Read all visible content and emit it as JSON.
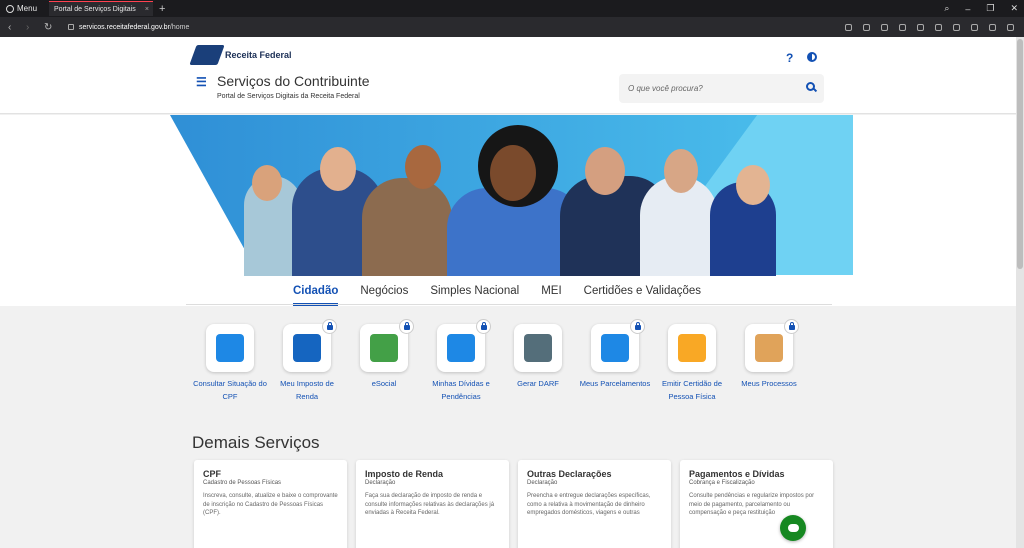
{
  "browser": {
    "menu_label": "Menu",
    "tab_title": "Portal de Serviços Digitais",
    "url_host": "servicos.receitafederal.gov.br",
    "url_path": "/home"
  },
  "header": {
    "logo_text": "Receita Federal",
    "help_label": "?",
    "title": "Serviços do Contribuinte",
    "subtitle": "Portal de Serviços Digitais da Receita Federal",
    "search_placeholder": "O que você procura?"
  },
  "tabs": [
    "Cidadão",
    "Negócios",
    "Simples Nacional",
    "MEI",
    "Certidões e Validações"
  ],
  "services": [
    {
      "label": "Consultar Situação do CPF",
      "locked": false,
      "icon": "cpf-card-icon",
      "color": "#1e88e5"
    },
    {
      "label": "Meu Imposto de Renda",
      "locked": true,
      "icon": "income-tax-icon",
      "color": "#1565c0"
    },
    {
      "label": "eSocial",
      "locked": true,
      "icon": "esocial-icon",
      "color": "#43a047"
    },
    {
      "label": "Minhas Dívidas e Pendências",
      "locked": true,
      "icon": "warning-triangle-icon",
      "color": "#1e88e5"
    },
    {
      "label": "Gerar DARF",
      "locked": false,
      "icon": "darf-barcode-icon",
      "color": "#546e7a"
    },
    {
      "label": "Meus Parcelamentos",
      "locked": true,
      "icon": "calendar-percent-icon",
      "color": "#1e88e5"
    },
    {
      "label": "Emitir Certidão de Pessoa Física",
      "locked": false,
      "icon": "certificate-pf-icon",
      "color": "#f9a825"
    },
    {
      "label": "Meus Processos",
      "locked": true,
      "icon": "folder-icon",
      "color": "#e0a35a"
    }
  ],
  "demais_title": "Demais Serviços",
  "cards": [
    {
      "title": "CPF",
      "subtitle": "Cadastro de Pessoas Físicas",
      "desc": "Inscreva, consulte, atualize e baixe o comprovante de inscrição no Cadastro de Pessoas Físicas (CPF)."
    },
    {
      "title": "Imposto de Renda",
      "subtitle": "Declaração",
      "desc": "Faça sua declaração de imposto de renda e consulte informações relativas às declarações já enviadas à Receita Federal."
    },
    {
      "title": "Outras Declarações",
      "subtitle": "Declaração",
      "desc": "Preencha e entregue declarações específicas, como a relativa à movimentação de dinheiro empregados domésticos, viagens e outras"
    },
    {
      "title": "Pagamentos e Dívidas",
      "subtitle": "Cobrança e Fiscalização",
      "desc": "Consulte pendências e regularize impostos por meio de pagamento, parcelamento ou compensação e peça restituição"
    }
  ]
}
